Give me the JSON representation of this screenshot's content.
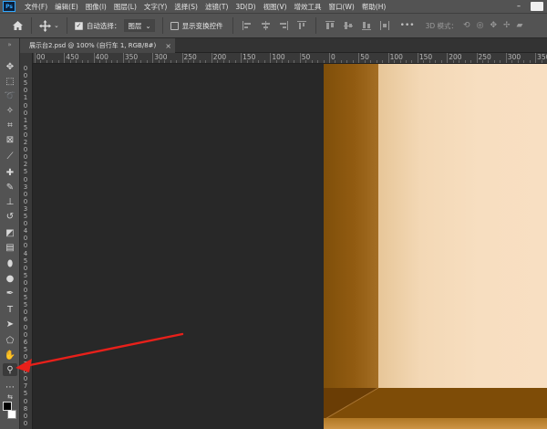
{
  "app": {
    "logo": "Ps"
  },
  "menu": [
    "文件(F)",
    "编辑(E)",
    "图像(I)",
    "图层(L)",
    "文字(Y)",
    "选择(S)",
    "滤镜(T)",
    "3D(D)",
    "视图(V)",
    "增效工具",
    "窗口(W)",
    "帮助(H)"
  ],
  "window_controls": {
    "minimize": "–",
    "maximize": "☐"
  },
  "options": {
    "home_icon": "home-icon",
    "auto_select_label": "自动选择：",
    "auto_select_checked": true,
    "layer_select_value": "图层",
    "show_transform_label": "显示变换控件",
    "show_transform_checked": false,
    "three_d_label": "3D 模式：",
    "more": "•••"
  },
  "document": {
    "tab_title": "展示台2.psd @ 100% (自行车 1, RGB/8#)",
    "close": "×"
  },
  "ruler": {
    "top_labels": [
      "00",
      "450",
      "400",
      "350",
      "300",
      "250",
      "200",
      "150",
      "100",
      "50",
      "0",
      "50",
      "100",
      "150",
      "200",
      "250",
      "300",
      "350",
      "400"
    ],
    "left_labels": [
      "0",
      "0",
      "5",
      "0",
      "1",
      "0",
      "0",
      "1",
      "5",
      "0",
      "2",
      "0",
      "0",
      "2",
      "5",
      "0",
      "3",
      "0",
      "0",
      "3",
      "5",
      "0",
      "4",
      "0",
      "0",
      "4",
      "5",
      "0",
      "5",
      "0",
      "0",
      "5",
      "5",
      "0",
      "6",
      "0",
      "0",
      "6",
      "5",
      "0",
      "7",
      "0",
      "0",
      "7",
      "5",
      "0",
      "8",
      "0",
      "0"
    ]
  },
  "tools": [
    "move-tool",
    "marquee-tool",
    "lasso-tool",
    "magic-wand-tool",
    "crop-tool",
    "frame-tool",
    "eyedropper-tool",
    "healing-brush-tool",
    "brush-tool",
    "clone-stamp-tool",
    "history-brush-tool",
    "eraser-tool",
    "gradient-tool",
    "blur-tool",
    "dodge-tool",
    "pen-tool",
    "type-tool",
    "path-selection-tool",
    "shape-tool",
    "hand-tool",
    "zoom-tool",
    "edit-toolbar",
    "swap-colors",
    "foreground-color",
    "background-color"
  ],
  "colors": {
    "ui_dark": "#535353",
    "canvas_bg": "#282828",
    "wall": "#f8dfc2",
    "floor": "#7e4c07",
    "arrow": "#e8201a"
  }
}
